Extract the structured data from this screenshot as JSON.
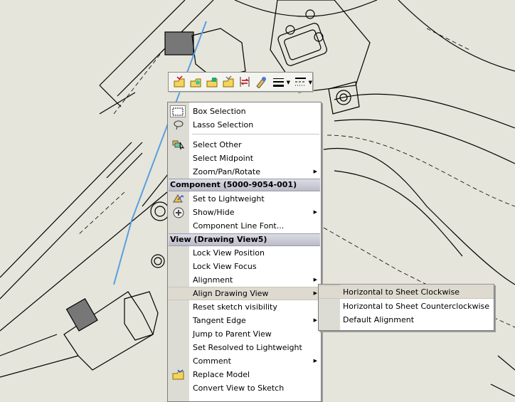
{
  "toolbar": {
    "items": [
      {
        "name": "open-part-icon"
      },
      {
        "name": "open-assembly-icon"
      },
      {
        "name": "open-drawing-icon"
      },
      {
        "name": "open-model-icon"
      },
      {
        "name": "dimension-icon"
      },
      {
        "name": "appearance-icon"
      },
      {
        "name": "line-thickness-icon",
        "dropdown": true
      },
      {
        "name": "line-style-icon",
        "dropdown": true
      }
    ]
  },
  "menu": {
    "box_selection": "Box Selection",
    "lasso_selection": "Lasso Selection",
    "select_other": "Select Other",
    "select_midpoint": "Select Midpoint",
    "zoom_pan_rotate": "Zoom/Pan/Rotate",
    "component_header": "Component (5000-9054-001)",
    "set_lightweight": "Set to Lightweight",
    "show_hide": "Show/Hide",
    "component_line_font": "Component Line Font...",
    "view_header": "View (Drawing View5)",
    "lock_view_position": "Lock View Position",
    "lock_view_focus": "Lock View Focus",
    "alignment": "Alignment",
    "align_drawing_view": "Align Drawing View",
    "reset_sketch_visibility": "Reset sketch visibility",
    "tangent_edge": "Tangent Edge",
    "jump_to_parent": "Jump to Parent View",
    "set_resolved": "Set Resolved to Lightweight",
    "comment": "Comment",
    "replace_model": "Replace Model",
    "convert_view": "Convert View to Sketch"
  },
  "submenu": {
    "horizontal_cw": "Horizontal to Sheet Clockwise",
    "horizontal_ccw": "Horizontal to Sheet Counterclockwise",
    "default_alignment": "Default Alignment"
  },
  "colors": {
    "sheet": "#e5e5db",
    "highlight": "#dedad0",
    "header": "#c8c8d4",
    "selected_edge": "#5a9ee0"
  }
}
